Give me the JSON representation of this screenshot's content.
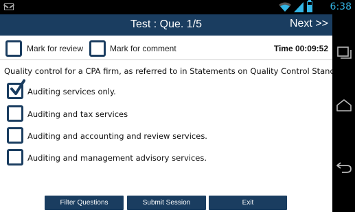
{
  "status_bar": {
    "time": "6:38",
    "icons": [
      "mail-icon",
      "wifi-icon",
      "signal-icon",
      "battery-icon"
    ]
  },
  "header": {
    "title": "Test : Que. 1/5",
    "next_label": "Next >>"
  },
  "toolbar": {
    "mark_review_label": "Mark for review",
    "mark_review_checked": false,
    "mark_comment_label": "Mark for comment",
    "mark_comment_checked": false,
    "timer": "Time 00:09:52"
  },
  "question": {
    "text": "Quality control for a CPA firm, as referred to in Statements on Quality Control Standards"
  },
  "options": [
    {
      "label": "Auditing services only.",
      "checked": true
    },
    {
      "label": "Auditing and tax services",
      "checked": false
    },
    {
      "label": "Auditing and accounting and review services.",
      "checked": false
    },
    {
      "label": "Auditing and management advisory services.",
      "checked": false
    }
  ],
  "buttons": {
    "filter": "Filter Questions",
    "submit": "Submit Session",
    "exit": "Exit"
  },
  "nav_bar": {
    "icons": [
      "home-icon",
      "back-icon",
      "recent-apps-icon"
    ]
  },
  "colors": {
    "primary": "#1a3d60",
    "status_accent": "#33b5e5"
  }
}
